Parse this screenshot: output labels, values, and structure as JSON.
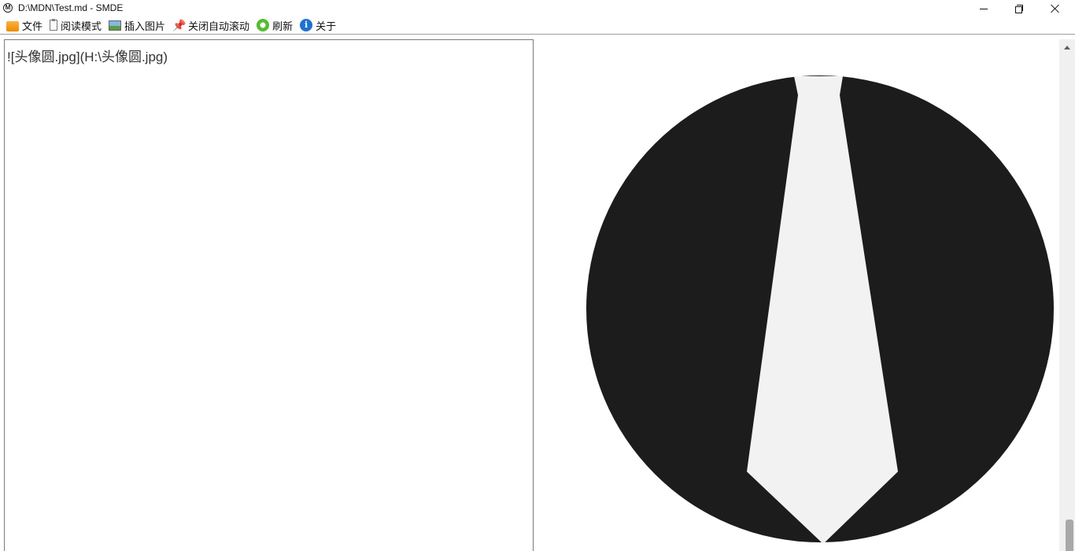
{
  "window": {
    "title": "D:\\MDN\\Test.md - SMDE",
    "app_icon_letter": "M"
  },
  "menu": {
    "items": [
      {
        "label": "文件",
        "icon": "folder-icon"
      },
      {
        "label": "阅读模式",
        "icon": "clipboard-icon"
      },
      {
        "label": "插入图片",
        "icon": "image-icon"
      },
      {
        "label": "关闭自动滚动",
        "icon": "pin-icon"
      },
      {
        "label": "刷新",
        "icon": "refresh-icon"
      },
      {
        "label": "关于",
        "icon": "info-icon"
      }
    ]
  },
  "editor": {
    "content": "![头像圆.jpg](H:\\头像圆.jpg)"
  },
  "preview": {
    "image_alt": "头像圆.jpg",
    "circle_color": "#1c1c1c",
    "tie_color": "#f2f2f2"
  }
}
